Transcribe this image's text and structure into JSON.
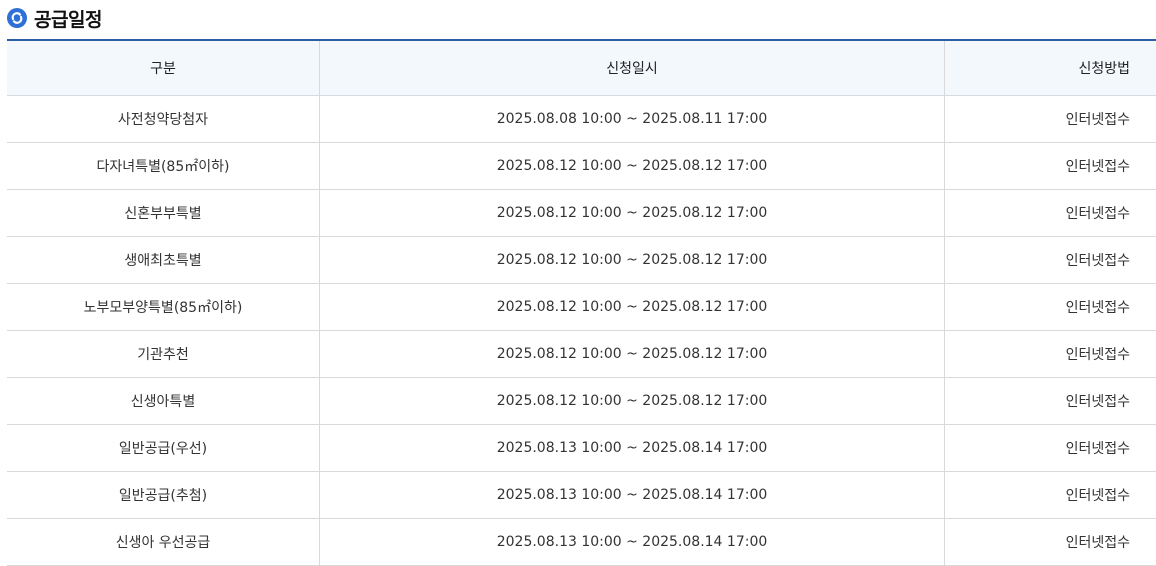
{
  "section": {
    "title": "공급일정",
    "icon": "refresh-icon"
  },
  "table": {
    "headers": [
      "구분",
      "신청일시",
      "신청방법"
    ],
    "rows": [
      {
        "type": "사전청약당첨자",
        "period": "2025.08.08 10:00 ~ 2025.08.11 17:00",
        "method": "인터넷접수"
      },
      {
        "type": "다자녀특별(85㎡이하)",
        "period": "2025.08.12 10:00 ~ 2025.08.12 17:00",
        "method": "인터넷접수"
      },
      {
        "type": "신혼부부특별",
        "period": "2025.08.12 10:00 ~ 2025.08.12 17:00",
        "method": "인터넷접수"
      },
      {
        "type": "생애최초특별",
        "period": "2025.08.12 10:00 ~ 2025.08.12 17:00",
        "method": "인터넷접수"
      },
      {
        "type": "노부모부양특별(85㎡이하)",
        "period": "2025.08.12 10:00 ~ 2025.08.12 17:00",
        "method": "인터넷접수"
      },
      {
        "type": "기관추천",
        "period": "2025.08.12 10:00 ~ 2025.08.12 17:00",
        "method": "인터넷접수"
      },
      {
        "type": "신생아특별",
        "period": "2025.08.12 10:00 ~ 2025.08.12 17:00",
        "method": "인터넷접수"
      },
      {
        "type": "일반공급(우선)",
        "period": "2025.08.13 10:00 ~ 2025.08.14 17:00",
        "method": "인터넷접수"
      },
      {
        "type": "일반공급(추첨)",
        "period": "2025.08.13 10:00 ~ 2025.08.14 17:00",
        "method": "인터넷접수"
      },
      {
        "type": "신생아 우선공급",
        "period": "2025.08.13 10:00 ~ 2025.08.14 17:00",
        "method": "인터넷접수"
      }
    ]
  },
  "colors": {
    "accent": "#2b5ea7",
    "header_bg": "#f3f8fd",
    "icon": "#2f6fd6"
  }
}
